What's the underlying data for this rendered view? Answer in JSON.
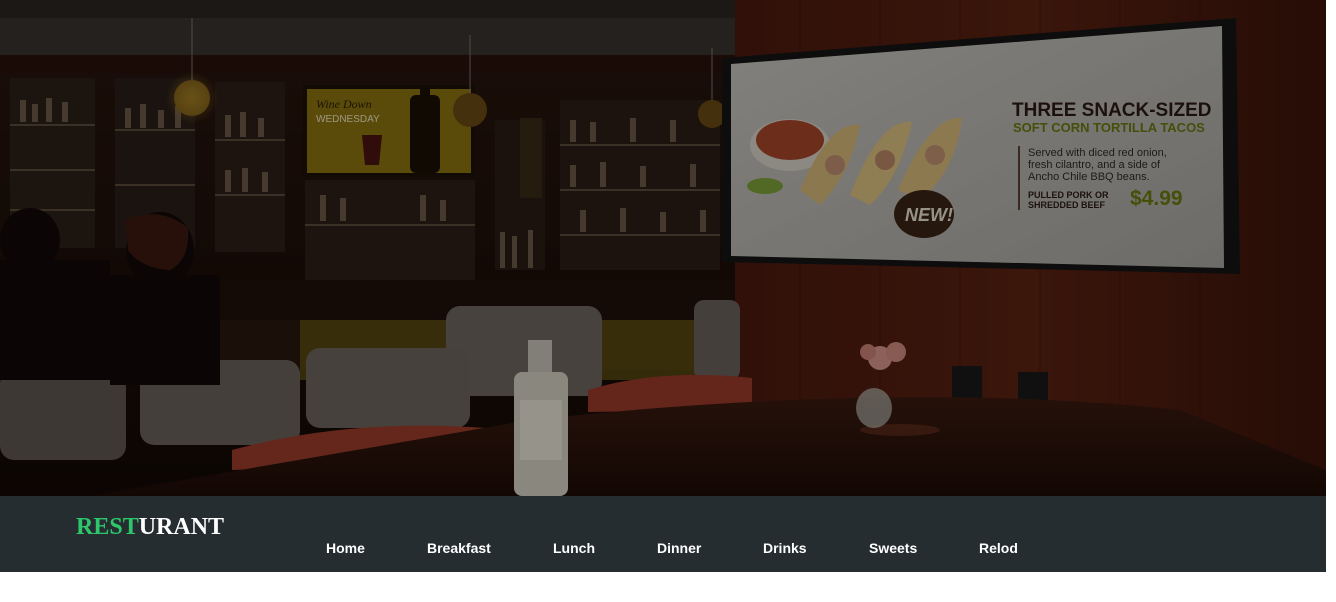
{
  "hero": {
    "wine_sign_line1": "Wine Down",
    "wine_sign_line2": "WEDNESDAY",
    "tv": {
      "headline": "THREE SNACK-SIZED",
      "subheadline": "SOFT CORN TORTILLA TACOS",
      "description_line1": "Served with diced red onion,",
      "description_line2": "fresh cilantro, and a side of",
      "description_line3": "Ancho Chile BBQ beans.",
      "option_line1": "PULLED PORK OR",
      "option_line2": "SHREDDED BEEF",
      "price": "$4.99",
      "badge": "NEW!"
    }
  },
  "navbar": {
    "logo_accent": "REST",
    "logo_rest": "URANT",
    "items": [
      {
        "label": "Home"
      },
      {
        "label": "Breakfast"
      },
      {
        "label": "Lunch"
      },
      {
        "label": "Dinner"
      },
      {
        "label": "Drinks"
      },
      {
        "label": "Sweets"
      },
      {
        "label": "Relod"
      }
    ]
  },
  "colors": {
    "navbar_bg": "#262d30",
    "logo_accent": "#2ec66b",
    "menu_text": "#ffffff"
  }
}
